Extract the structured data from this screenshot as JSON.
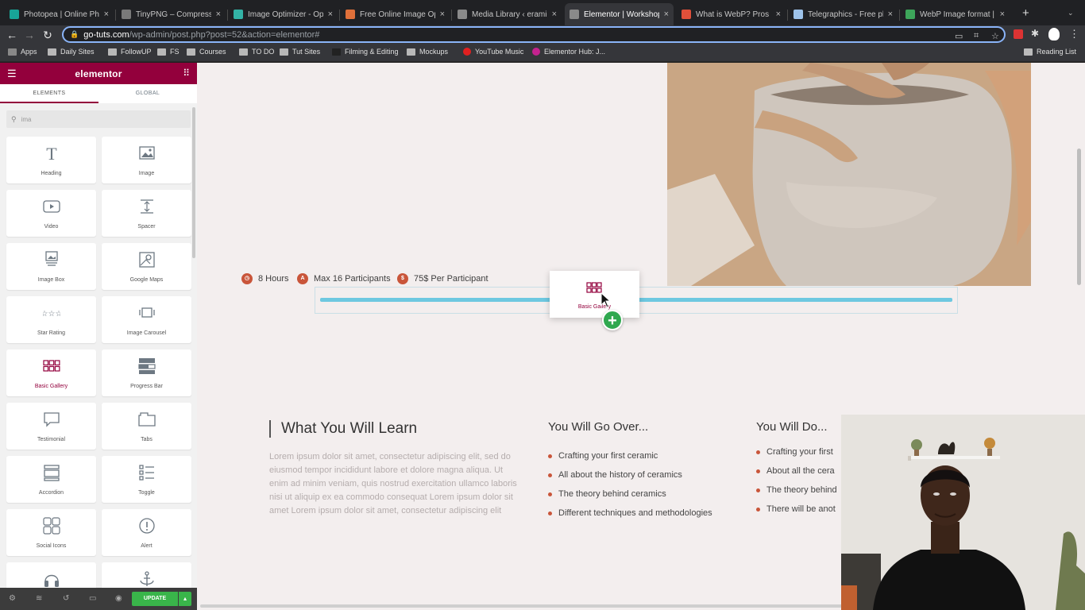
{
  "browser": {
    "tabs": [
      {
        "title": "Photopea | Online Phot",
        "color": "#18a497"
      },
      {
        "title": "TinyPNG – Compress W",
        "color": "#7a7a7a"
      },
      {
        "title": "Image Optimizer - Opti",
        "color": "#33b3a6"
      },
      {
        "title": "Free Online Image Opti",
        "color": "#e0703a"
      },
      {
        "title": "Media Library ‹ eramic",
        "color": "#8a8a8a"
      },
      {
        "title": "Elementor | Workshop",
        "color": "#8a8a8a",
        "active": true
      },
      {
        "title": "What is WebP? Pros an",
        "color": "#e0503a"
      },
      {
        "title": "Telegraphics - Free plu",
        "color": "#9ec3ea"
      },
      {
        "title": "WebP Image format | G",
        "color": "#3da55a"
      }
    ],
    "new_tab": "+",
    "url_domain": "go-tuts.com",
    "url_path": "/wp-admin/post.php?post=52&action=elementor#",
    "bookmarks": [
      {
        "label": "Apps",
        "kind": "apps"
      },
      {
        "label": "Daily Sites",
        "kind": "folder"
      },
      {
        "label": "FollowUP",
        "kind": "folder"
      },
      {
        "label": "FS",
        "kind": "folder"
      },
      {
        "label": "Courses",
        "kind": "folder"
      },
      {
        "label": "TO DO",
        "kind": "folder"
      },
      {
        "label": "Tut Sites",
        "kind": "folder"
      },
      {
        "label": "Filming & Editing",
        "kind": "site"
      },
      {
        "label": "Mockups",
        "kind": "folder"
      },
      {
        "label": "YouTube Music",
        "kind": "yt"
      },
      {
        "label": "Elementor Hub: J...",
        "kind": "el"
      }
    ],
    "reading_list": "Reading List"
  },
  "panel": {
    "brand": "elementor",
    "tabs": [
      "ELEMENTS",
      "GLOBAL"
    ],
    "search_value": "ima",
    "widgets": [
      {
        "label": "Heading",
        "icon": "heading-icon"
      },
      {
        "label": "Image",
        "icon": "image-icon"
      },
      {
        "label": "Video",
        "icon": "video-icon"
      },
      {
        "label": "Spacer",
        "icon": "spacer-icon"
      },
      {
        "label": "Image Box",
        "icon": "image-box-icon"
      },
      {
        "label": "Google Maps",
        "icon": "google-maps-icon"
      },
      {
        "label": "Star Rating",
        "icon": "star-rating-icon"
      },
      {
        "label": "Image Carousel",
        "icon": "image-carousel-icon"
      },
      {
        "label": "Basic Gallery",
        "icon": "basic-gallery-icon",
        "highlight": true
      },
      {
        "label": "Progress Bar",
        "icon": "progress-bar-icon"
      },
      {
        "label": "Testimonial",
        "icon": "testimonial-icon"
      },
      {
        "label": "Tabs",
        "icon": "tabs-icon"
      },
      {
        "label": "Accordion",
        "icon": "accordion-icon"
      },
      {
        "label": "Toggle",
        "icon": "toggle-icon"
      },
      {
        "label": "Social Icons",
        "icon": "social-icons-icon"
      },
      {
        "label": "Alert",
        "icon": "alert-icon"
      },
      {
        "label": "",
        "icon": "headphones-icon"
      },
      {
        "label": "",
        "icon": "anchor-icon"
      }
    ],
    "update_label": "UPDATE",
    "accent": "#93003c",
    "update_color": "#39b54a"
  },
  "canvas": {
    "meta": [
      {
        "label": "8 Hours",
        "glyph": "◷"
      },
      {
        "label": "Max 16 Participants",
        "glyph": "A"
      },
      {
        "label": "75$ Per Participant",
        "glyph": "$"
      }
    ],
    "drag_widget_label": "Basic Gallery",
    "learn": {
      "title": "What You Will Learn",
      "body": "Lorem ipsum dolor sit amet, consectetur adipiscing elit, sed do eiusmod tempor incididunt labore et dolore magna aliqua. Ut enim ad minim veniam, quis nostrud exercitation ullamco laboris nisi ut aliquip ex ea commodo consequat Lorem ipsum dolor sit amet Lorem ipsum dolor sit amet, consectetur adipiscing elit"
    },
    "go_over": {
      "title": "You Will Go Over...",
      "items": [
        "Crafting your first ceramic",
        "All about the history of ceramics",
        "The theory behind ceramics",
        "Different techniques and methodologies"
      ]
    },
    "will_do": {
      "title": "You Will Do...",
      "items": [
        "Crafting your first",
        "About all the cera",
        "The theory behind",
        "There will be anot"
      ]
    },
    "accent_dot": "#c9553a",
    "drop_indicator": "#6ec8e0"
  }
}
